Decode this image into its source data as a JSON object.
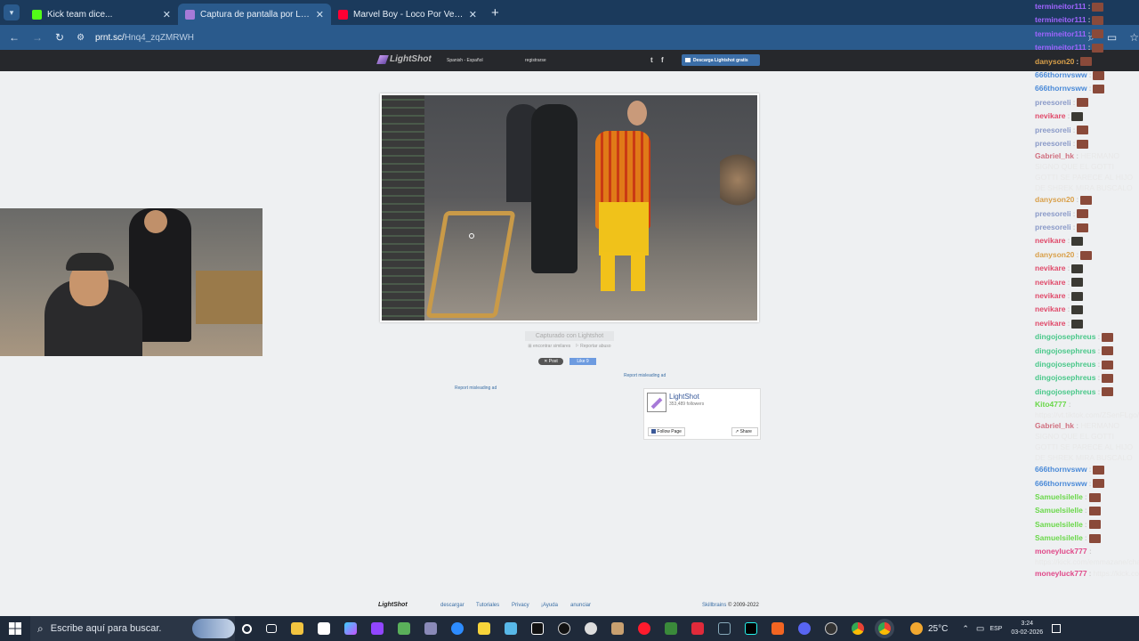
{
  "browser": {
    "tabs": [
      {
        "title": "Kick team dice...",
        "favicon_color": "#53fc18"
      },
      {
        "title": "Captura de pantalla por Lightsh",
        "favicon_color": "#a77ad8"
      },
      {
        "title": "Marvel Boy - Loco Por Vernos (",
        "favicon_color": "#ff0033"
      }
    ],
    "url_domain": "prnt.sc/",
    "url_path": "Hnq4_zqZMRWH"
  },
  "site": {
    "logo": "LightShot",
    "lang": "Spanish - Español",
    "register": "registrarse",
    "download": "Descarga Lightshot gratis",
    "twitter_icon": "t",
    "facebook_icon": "f"
  },
  "content": {
    "captured": "Capturado con Lightshot",
    "similar": "encontrar similares",
    "report": "Reportar abuso",
    "post_btn": "Post",
    "like_btn": "Like 9",
    "report_ad_1": "Report misleading ad",
    "report_ad_2": "Report misleading ad",
    "fb_page_name": "LightShot",
    "fb_followers": "353,489 followers",
    "fb_follow": "Follow Page",
    "fb_share": "Share"
  },
  "footer": {
    "logo": "LightShot",
    "links": [
      "descargar",
      "Tutoriales",
      "Privacy",
      "¡Ayuda",
      "anunciar"
    ],
    "copyright_brand": "Skillbrains",
    "copyright": "© 2009-2022"
  },
  "chat": [
    {
      "user": "termineitor111",
      "color": "#a064ff",
      "msg": ""
    },
    {
      "user": "termineitor111",
      "color": "#a064ff",
      "msg": ""
    },
    {
      "user": "termineitor111",
      "color": "#a064ff",
      "msg": ""
    },
    {
      "user": "termineitor111",
      "color": "#a064ff",
      "msg": ""
    },
    {
      "user": "danyson20",
      "color": "#d9a04a",
      "msg": ""
    },
    {
      "user": "666thornvsww",
      "color": "#4a8ad8",
      "msg": ""
    },
    {
      "user": "666thornvsww",
      "color": "#4a8ad8",
      "msg": ""
    },
    {
      "user": "preesoreli",
      "color": "#8a9ac8",
      "msg": ""
    },
    {
      "user": "nevikare",
      "color": "#e04a6a",
      "msg": ""
    },
    {
      "user": "preesoreli",
      "color": "#8a9ac8",
      "msg": ""
    },
    {
      "user": "preesoreli",
      "color": "#8a9ac8",
      "msg": ""
    },
    {
      "user": "Gabriel_hk",
      "color": "#d07080",
      "msg": "HERMANO SIGNO QUE EL GOTTI GOTTI SE PARECE AL HIJO DE SHREK MIRA BUSCALO",
      "wrap": true
    },
    {
      "user": "danyson20",
      "color": "#d9a04a",
      "msg": ""
    },
    {
      "user": "preesoreli",
      "color": "#8a9ac8",
      "msg": ""
    },
    {
      "user": "preesoreli",
      "color": "#8a9ac8",
      "msg": ""
    },
    {
      "user": "nevikare",
      "color": "#e04a6a",
      "msg": ""
    },
    {
      "user": "danyson20",
      "color": "#d9a04a",
      "msg": ""
    },
    {
      "user": "nevikare",
      "color": "#e04a6a",
      "msg": ""
    },
    {
      "user": "nevikare",
      "color": "#e04a6a",
      "msg": ""
    },
    {
      "user": "nevikare",
      "color": "#e04a6a",
      "msg": ""
    },
    {
      "user": "nevikare",
      "color": "#e04a6a",
      "msg": ""
    },
    {
      "user": "nevikare",
      "color": "#e04a6a",
      "msg": ""
    },
    {
      "user": "dingojosephreus",
      "color": "#4ac88a",
      "msg": ""
    },
    {
      "user": "dingojosephreus",
      "color": "#4ac88a",
      "msg": ""
    },
    {
      "user": "dingojosephreus",
      "color": "#4ac88a",
      "msg": ""
    },
    {
      "user": "dingojosephreus",
      "color": "#4ac88a",
      "msg": ""
    },
    {
      "user": "dingojosephreus",
      "color": "#4ac88a",
      "msg": ""
    },
    {
      "user": "Kito4777",
      "color": "#6ad84a",
      "msg": "https://vt.tiktok.com/ZSenFLgo/",
      "wrap": true
    },
    {
      "user": "Gabriel_hk",
      "color": "#d07080",
      "msg": "HERMANO SIGNO QUE EL GOTTI GOTTI SE PARECE AL HIJO DE SHREK MIRA BUSCALO",
      "wrap": true
    },
    {
      "user": "666thornvsww",
      "color": "#4a8ad8",
      "msg": ""
    },
    {
      "user": "666thornvsww",
      "color": "#4a8ad8",
      "msg": ""
    },
    {
      "user": "Samuelsilelle",
      "color": "#6ad84a",
      "msg": ""
    },
    {
      "user": "Samuelsilelle",
      "color": "#6ad84a",
      "msg": ""
    },
    {
      "user": "Samuelsilelle",
      "color": "#6ad84a",
      "msg": ""
    },
    {
      "user": "Samuelsilelle",
      "color": "#6ad84a",
      "msg": ""
    },
    {
      "user": "moneyluck777",
      "color": "#e04a8a",
      "msg": "https://kick.com/emmazane/chat",
      "wrap": true
    },
    {
      "user": "moneyluck777",
      "color": "#e04a8a",
      "msg": "https://kick.com/emmazane/c"
    }
  ],
  "taskbar": {
    "search_placeholder": "Escribe aquí para buscar.",
    "weather": "25°C",
    "lang": "ESP",
    "time": "3:24",
    "date": "03-02-2026"
  }
}
